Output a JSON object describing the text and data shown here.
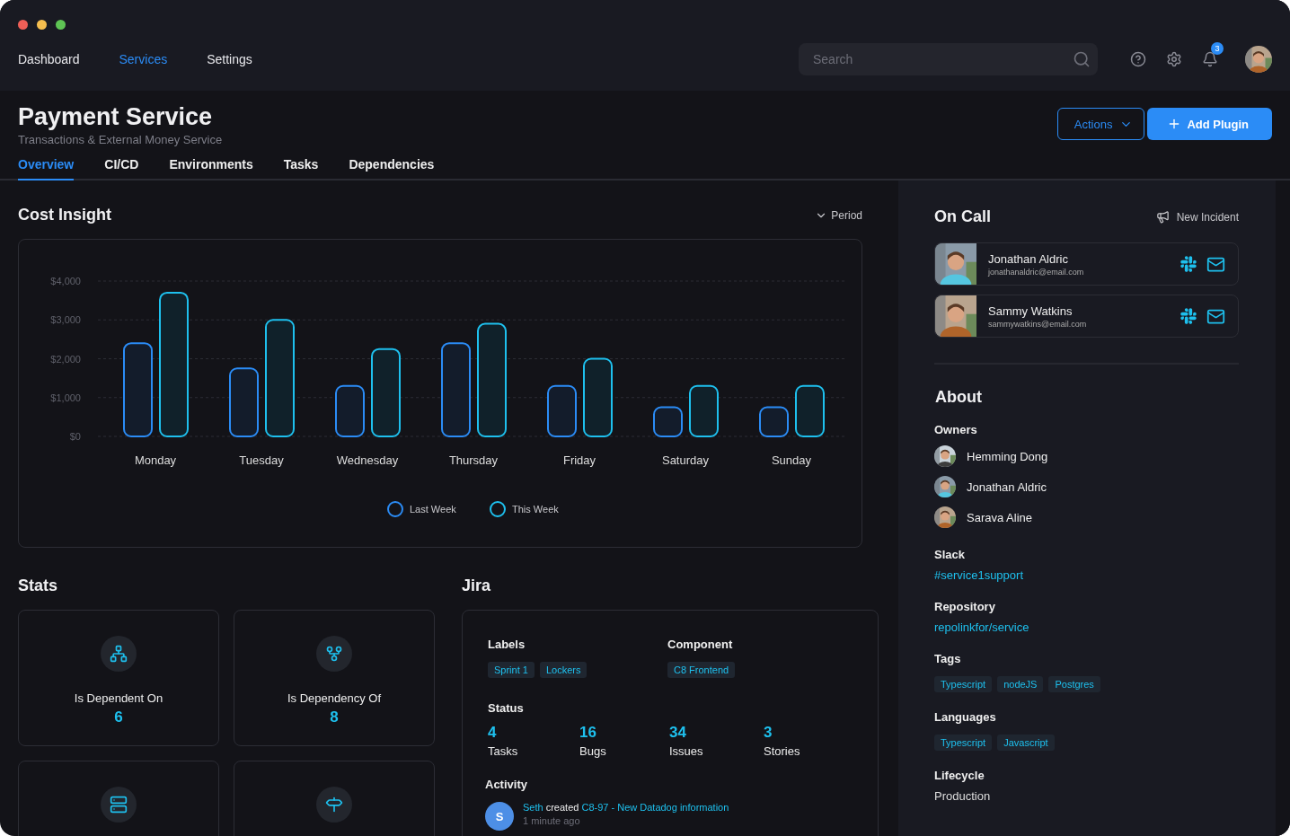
{
  "nav": {
    "items": [
      {
        "label": "Dashboard",
        "selected": false
      },
      {
        "label": "Services",
        "selected": true
      },
      {
        "label": "Settings",
        "selected": false
      }
    ]
  },
  "search": {
    "placeholder": "Search"
  },
  "notifications": {
    "count": "3"
  },
  "page": {
    "title": "Payment Service",
    "subtitle": "Transactions & External Money Service",
    "actions": "Actions",
    "add": "Add Plugin"
  },
  "tabs": [
    {
      "label": "Overview",
      "selected": true
    },
    {
      "label": "CI/CD",
      "selected": false
    },
    {
      "label": "Environments",
      "selected": false
    },
    {
      "label": "Tasks",
      "selected": false
    },
    {
      "label": "Dependencies",
      "selected": false
    }
  ],
  "cost_insight": {
    "title": "Cost Insight",
    "period": "Period",
    "chart_data": {
      "type": "bar",
      "grid": true,
      "legend": "bottom",
      "categories": [
        "Monday",
        "Tuesday",
        "Wednesday",
        "Thursday",
        "Friday",
        "Saturday",
        "Sunday"
      ],
      "ylim": [
        0,
        4000
      ],
      "yticks": [
        {
          "value": 0,
          "label": "$0"
        },
        {
          "value": 1000,
          "label": "$1,000"
        },
        {
          "value": 2000,
          "label": "$2,000"
        },
        {
          "value": 3000,
          "label": "$3,000"
        },
        {
          "value": 4000,
          "label": "$4,000"
        }
      ],
      "series": [
        {
          "name": "Last Week",
          "color": "#2b8cf6",
          "values": [
            2400,
            1750,
            1300,
            2400,
            1300,
            750,
            750
          ]
        },
        {
          "name": "This Week",
          "color": "#1ec0ee",
          "values": [
            3700,
            3000,
            2250,
            2900,
            2000,
            1300,
            1300
          ]
        }
      ]
    }
  },
  "stats": {
    "title": "Stats",
    "cards": [
      {
        "kind": "full",
        "label": "Is Dependent On",
        "value": "6"
      },
      {
        "kind": "full",
        "label": "Is Dependency Of",
        "value": "8"
      },
      {
        "kind": "partial"
      },
      {
        "kind": "partial"
      }
    ]
  },
  "jira": {
    "title": "Jira",
    "labels_title": "Labels",
    "labels": [
      "Sprint 1",
      "Lockers"
    ],
    "component_title": "Component",
    "components": [
      "C8 Frontend"
    ],
    "status_title": "Status",
    "status": [
      {
        "value": "4",
        "label": "Tasks"
      },
      {
        "value": "16",
        "label": "Bugs"
      },
      {
        "value": "34",
        "label": "Issues"
      },
      {
        "value": "3",
        "label": "Stories"
      }
    ],
    "activity_title": "Activity",
    "activity": [
      {
        "initial": "S",
        "user": "Seth",
        "verb": "created",
        "link": "C8-97 - New Datadog information",
        "time": "1 minute ago"
      }
    ]
  },
  "on_call": {
    "title": "On Call",
    "new_incident": "New Incident",
    "people": [
      {
        "name": "Jonathan Aldric",
        "email": "jonathanaldric@email.com"
      },
      {
        "name": "Sammy Watkins",
        "email": "sammywatkins@email.com"
      }
    ]
  },
  "about": {
    "title": "About",
    "owners_title": "Owners",
    "owners": [
      "Hemming Dong",
      "Jonathan Aldric",
      "Sarava Aline"
    ],
    "slack_title": "Slack",
    "slack": "#service1support",
    "repository_title": "Repository",
    "repository": "repolinkfor/service",
    "tags_title": "Tags",
    "tags": [
      "Typescript",
      "nodeJS",
      "Postgres"
    ],
    "languages_title": "Languages",
    "languages": [
      "Typescript",
      "Javascript"
    ],
    "lifecycle_title": "Lifecycle",
    "lifecycle": "Production"
  }
}
